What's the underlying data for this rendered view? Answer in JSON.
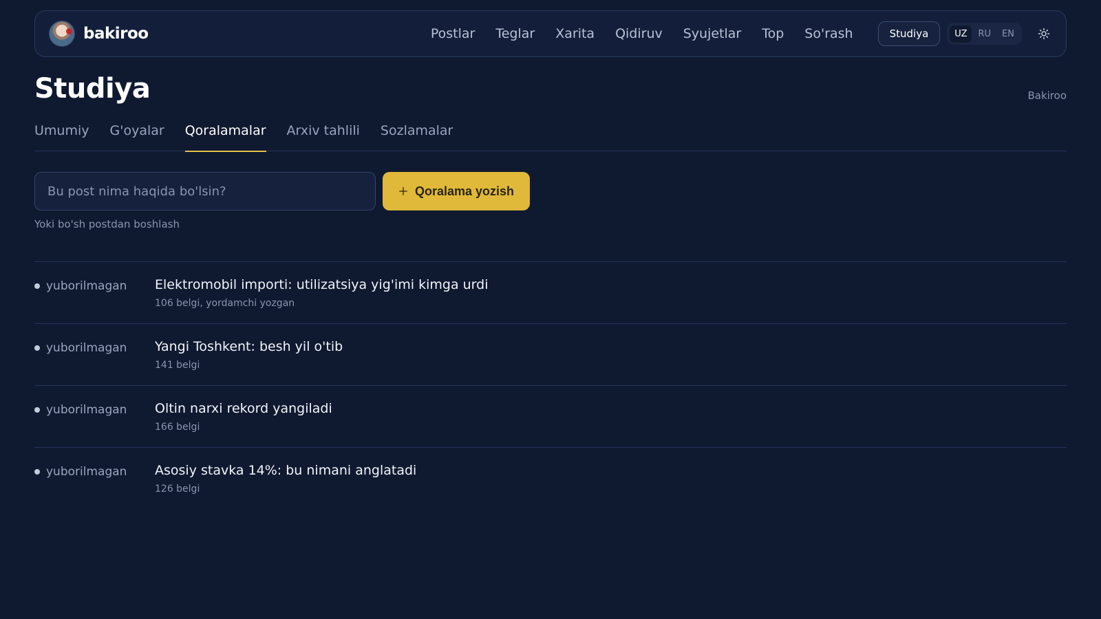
{
  "header": {
    "brand_name": "bakiroo",
    "nav": [
      "Postlar",
      "Teglar",
      "Xarita",
      "Qidiruv",
      "Syujetlar",
      "Top",
      "So'rash"
    ],
    "studio_button": "Studiya",
    "languages": [
      "UZ",
      "RU",
      "EN"
    ],
    "active_language": "UZ"
  },
  "page": {
    "title": "Studiya",
    "owner": "Bakiroo"
  },
  "tabs": [
    {
      "label": "Umumiy",
      "active": false
    },
    {
      "label": "G'oyalar",
      "active": false
    },
    {
      "label": "Qoralamalar",
      "active": true
    },
    {
      "label": "Arxiv tahlili",
      "active": false
    },
    {
      "label": "Sozlamalar",
      "active": false
    }
  ],
  "composer": {
    "placeholder": "Bu post nima haqida bo'lsin?",
    "value": "",
    "button_label": "Qoralama yozish",
    "blank_link": "Yoki bo'sh postdan boshlash"
  },
  "drafts": [
    {
      "status": "yuborilmagan",
      "title": "Elektromobil importi: utilizatsiya yig'imi kimga urdi",
      "meta": "106 belgi, yordamchi yozgan"
    },
    {
      "status": "yuborilmagan",
      "title": "Yangi Toshkent: besh yil o'tib",
      "meta": "141 belgi"
    },
    {
      "status": "yuborilmagan",
      "title": "Oltin narxi rekord yangiladi",
      "meta": "166 belgi"
    },
    {
      "status": "yuborilmagan",
      "title": "Asosiy stavka 14%: bu nimani anglatadi",
      "meta": "126 belgi"
    }
  ],
  "colors": {
    "background": "#0f1930",
    "accent": "#e0b93a",
    "border": "#24345a"
  },
  "icons": {
    "theme_toggle": "sun-icon",
    "write_button": "sparkle-icon"
  }
}
